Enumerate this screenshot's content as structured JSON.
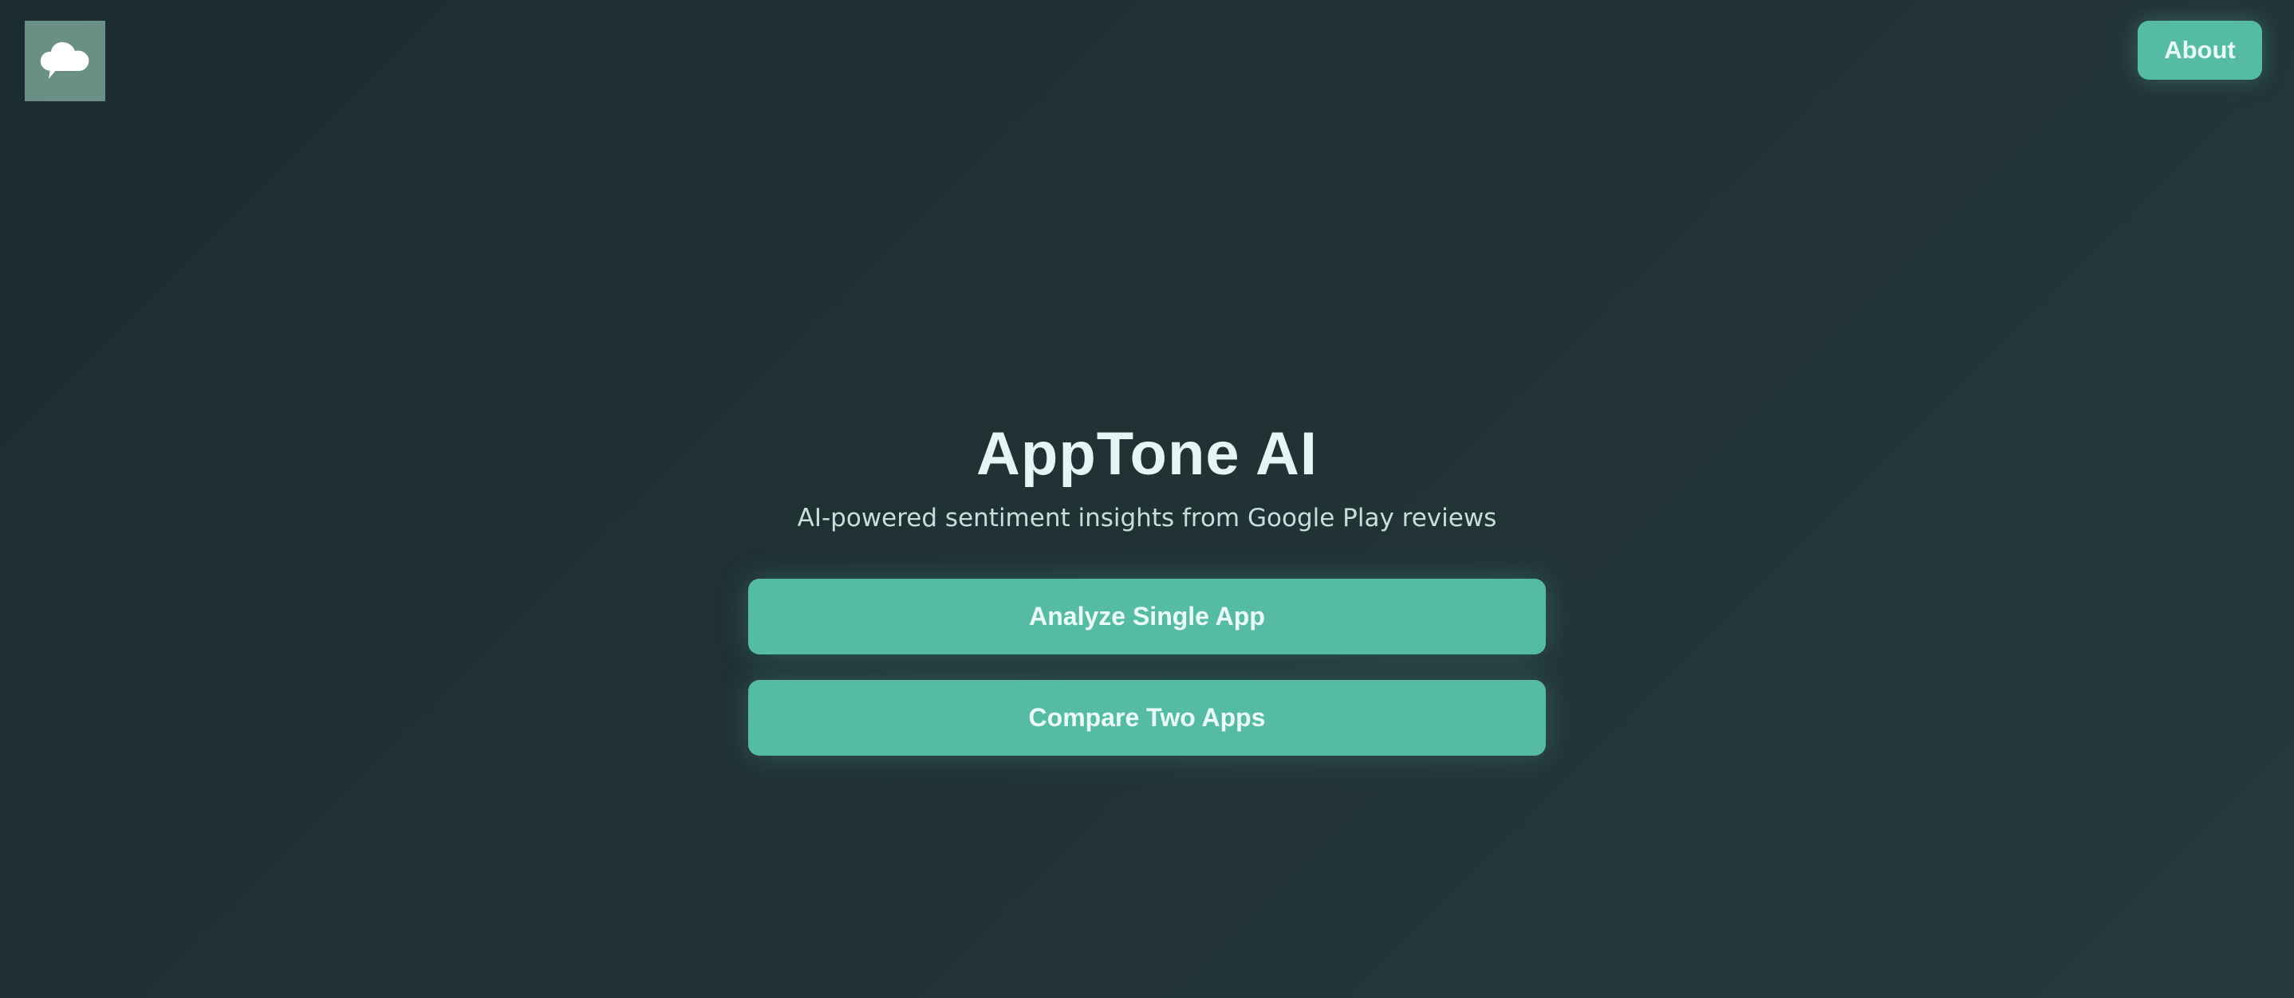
{
  "header": {
    "logo_icon": "cloud-speech-bubble-icon",
    "about_label": "About"
  },
  "hero": {
    "title": "AppTone AI",
    "subtitle": "AI-powered sentiment insights from Google Play reviews"
  },
  "actions": {
    "analyze_label": "Analyze Single App",
    "compare_label": "Compare Two Apps"
  },
  "colors": {
    "background": "#1f3033",
    "accent": "#56bba5",
    "logo_bg": "#6a8f85",
    "title_text": "#e3f6f4"
  }
}
